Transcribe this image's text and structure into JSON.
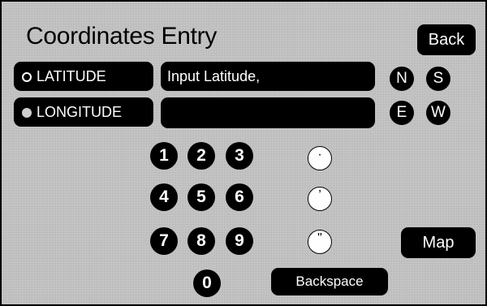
{
  "header": {
    "title": "Coordinates Entry",
    "back_label": "Back"
  },
  "coordinates": {
    "latitude_label": "LATITUDE",
    "longitude_label": "LONGITUDE",
    "latitude_value": "Input Latitude,",
    "longitude_value": "",
    "selected": "longitude"
  },
  "directions": {
    "n": "N",
    "s": "S",
    "e": "E",
    "w": "W"
  },
  "keypad": {
    "k1": "1",
    "k2": "2",
    "k3": "3",
    "k4": "4",
    "k5": "5",
    "k6": "6",
    "k7": "7",
    "k8": "8",
    "k9": "9",
    "k0": "0"
  },
  "symbols": {
    "degree": "·",
    "minute": "’",
    "second": "\""
  },
  "actions": {
    "map_label": "Map",
    "backspace_label": "Backspace"
  }
}
